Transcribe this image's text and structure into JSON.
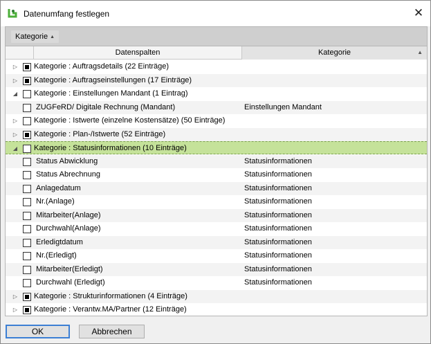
{
  "window": {
    "title": "Datenumfang festlegen",
    "close_glyph": "✕",
    "icon": "app-logo-icon"
  },
  "group_bar": {
    "chip_label": "Kategorie",
    "chip_sort_glyph": "▲"
  },
  "columns": {
    "col1": "Datenspalten",
    "col2": "Kategorie",
    "col2_sort_glyph": "▲"
  },
  "rows": [
    {
      "type": "group",
      "expand": "▷",
      "check": "indeterminate",
      "text": "Kategorie : Auftragsdetails (22 Einträge)",
      "cat": ""
    },
    {
      "type": "group",
      "expand": "▷",
      "check": "indeterminate",
      "text": "Kategorie : Auftragseinstellungen (17 Einträge)",
      "cat": ""
    },
    {
      "type": "group",
      "expand": "◢",
      "check": "unchecked",
      "text": "Kategorie : Einstellungen Mandant (1 Eintrag)",
      "cat": ""
    },
    {
      "type": "child",
      "expand": "",
      "check": "unchecked",
      "text": "ZUGFeRD/ Digitale Rechnung (Mandant)",
      "cat": "Einstellungen Mandant"
    },
    {
      "type": "group",
      "expand": "▷",
      "check": "unchecked",
      "text": "Kategorie : Istwerte (einzelne Kostensätze) (50 Einträge)",
      "cat": ""
    },
    {
      "type": "group",
      "expand": "▷",
      "check": "indeterminate",
      "text": "Kategorie : Plan-/Istwerte (52 Einträge)",
      "cat": ""
    },
    {
      "type": "group",
      "expand": "◢",
      "check": "unchecked",
      "text": "Kategorie : Statusinformationen (10 Einträge)",
      "cat": "",
      "selected": true
    },
    {
      "type": "child",
      "expand": "",
      "check": "unchecked",
      "text": "Status Abwicklung",
      "cat": "Statusinformationen"
    },
    {
      "type": "child",
      "expand": "",
      "check": "unchecked",
      "text": "Status Abrechnung",
      "cat": "Statusinformationen"
    },
    {
      "type": "child",
      "expand": "",
      "check": "unchecked",
      "text": "Anlagedatum",
      "cat": "Statusinformationen"
    },
    {
      "type": "child",
      "expand": "",
      "check": "unchecked",
      "text": "Nr.(Anlage)",
      "cat": "Statusinformationen"
    },
    {
      "type": "child",
      "expand": "",
      "check": "unchecked",
      "text": "Mitarbeiter(Anlage)",
      "cat": "Statusinformationen"
    },
    {
      "type": "child",
      "expand": "",
      "check": "unchecked",
      "text": "Durchwahl(Anlage)",
      "cat": "Statusinformationen"
    },
    {
      "type": "child",
      "expand": "",
      "check": "unchecked",
      "text": "Erledigtdatum",
      "cat": "Statusinformationen"
    },
    {
      "type": "child",
      "expand": "",
      "check": "unchecked",
      "text": "Nr.(Erledigt)",
      "cat": "Statusinformationen"
    },
    {
      "type": "child",
      "expand": "",
      "check": "unchecked",
      "text": "Mitarbeiter(Erledigt)",
      "cat": "Statusinformationen"
    },
    {
      "type": "child",
      "expand": "",
      "check": "unchecked",
      "text": "Durchwahl (Erledigt)",
      "cat": "Statusinformationen"
    },
    {
      "type": "group",
      "expand": "▷",
      "check": "indeterminate",
      "text": "Kategorie : Strukturinformationen (4 Einträge)",
      "cat": ""
    },
    {
      "type": "group",
      "expand": "▷",
      "check": "indeterminate",
      "text": "Kategorie : Verantw.MA/Partner (12 Einträge)",
      "cat": ""
    }
  ],
  "buttons": {
    "ok": "OK",
    "cancel": "Abbrechen"
  },
  "colors": {
    "selected_row": "#c5e29a",
    "ok_border": "#3c7fd4",
    "logo_green": "#4caf3a"
  }
}
